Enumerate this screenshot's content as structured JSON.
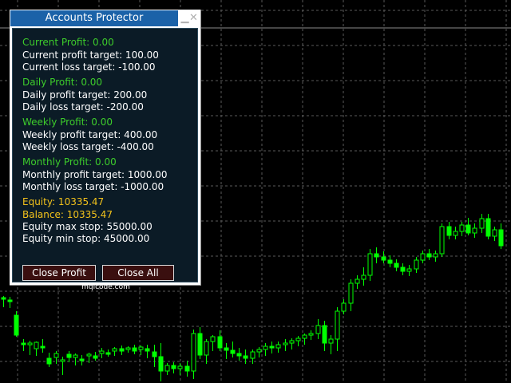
{
  "window": {
    "title": "Accounts Protector",
    "minimize_glyph": "▁",
    "close_glyph": "✕"
  },
  "current": {
    "profit_label": "Current Profit: 0.00",
    "profit_target": "Current profit target: 100.00",
    "loss_target": "Current loss target: -100.00"
  },
  "daily": {
    "profit_label": "Daily Profit: 0.00",
    "profit_target": "Daily profit target: 200.00",
    "loss_target": "Daily loss target: -200.00"
  },
  "weekly": {
    "profit_label": "Weekly Profit: 0.00",
    "profit_target": "Weekly profit target: 400.00",
    "loss_target": "Weekly loss target: -400.00"
  },
  "monthly": {
    "profit_label": "Monthly Profit: 0.00",
    "profit_target": "Monthly profit target: 1000.00",
    "loss_target": "Monthly loss target: -1000.00"
  },
  "account": {
    "equity": "Equity: 10335.47",
    "balance": "Balance: 10335.47",
    "equity_max_stop": "Equity max stop: 55000.00",
    "equity_min_stop": "Equity min stop: 45000.00"
  },
  "buttons": {
    "close_profit": "Close Profit",
    "close_all": "Close All"
  },
  "footer": {
    "site": "mqlcode.com"
  },
  "colors": {
    "background": "#000000",
    "grid": "#5a5a5a",
    "candle": "#00ff00",
    "caption": "#1b62a8",
    "panel": "#0b1b26",
    "profit_text": "#3dcc2b",
    "account_text": "#f2c21b",
    "button_bg": "#3a0f0f"
  },
  "chart_data": {
    "type": "candlestick",
    "series": [
      {
        "values": [
          {
            "open": 373,
            "high": 371,
            "low": 385,
            "close": 375
          },
          {
            "open": 376,
            "high": 372,
            "low": 386,
            "close": 378
          },
          {
            "open": 395,
            "high": 390,
            "low": 422,
            "close": 420
          },
          {
            "open": 430,
            "high": 425,
            "low": 440,
            "close": 432
          },
          {
            "open": 432,
            "high": 427,
            "low": 445,
            "close": 430
          },
          {
            "open": 437,
            "high": 428,
            "low": 446,
            "close": 429
          },
          {
            "open": 434,
            "high": 425,
            "low": 442,
            "close": 436
          },
          {
            "open": 449,
            "high": 442,
            "low": 460,
            "close": 456
          },
          {
            "open": 448,
            "high": 440,
            "low": 456,
            "close": 443
          },
          {
            "open": 453,
            "high": 447,
            "low": 470,
            "close": 451
          },
          {
            "open": 444,
            "high": 440,
            "low": 454,
            "close": 448
          },
          {
            "open": 448,
            "high": 443,
            "low": 458,
            "close": 445
          },
          {
            "open": 450,
            "high": 445,
            "low": 458,
            "close": 452
          },
          {
            "open": 446,
            "high": 442,
            "low": 455,
            "close": 444
          },
          {
            "open": 446,
            "high": 441,
            "low": 452,
            "close": 449
          },
          {
            "open": 443,
            "high": 436,
            "low": 449,
            "close": 440
          },
          {
            "open": 442,
            "high": 438,
            "low": 447,
            "close": 444
          },
          {
            "open": 440,
            "high": 435,
            "low": 446,
            "close": 437
          },
          {
            "open": 437,
            "high": 433,
            "low": 445,
            "close": 440
          },
          {
            "open": 438,
            "high": 434,
            "low": 442,
            "close": 436
          },
          {
            "open": 436,
            "high": 432,
            "low": 444,
            "close": 440
          },
          {
            "open": 438,
            "high": 433,
            "low": 445,
            "close": 435
          },
          {
            "open": 437,
            "high": 432,
            "low": 449,
            "close": 440
          },
          {
            "open": 441,
            "high": 432,
            "low": 460,
            "close": 447
          },
          {
            "open": 447,
            "high": 430,
            "low": 478,
            "close": 465
          },
          {
            "open": 465,
            "high": 455,
            "low": 470,
            "close": 458
          },
          {
            "open": 458,
            "high": 454,
            "low": 468,
            "close": 462
          },
          {
            "open": 462,
            "high": 455,
            "low": 470,
            "close": 459
          },
          {
            "open": 459,
            "high": 452,
            "low": 472,
            "close": 465
          },
          {
            "open": 465,
            "high": 413,
            "low": 475,
            "close": 418
          },
          {
            "open": 418,
            "high": 410,
            "low": 450,
            "close": 445
          },
          {
            "open": 445,
            "high": 425,
            "low": 456,
            "close": 428
          },
          {
            "open": 428,
            "high": 420,
            "low": 440,
            "close": 422
          },
          {
            "open": 422,
            "high": 414,
            "low": 440,
            "close": 436
          },
          {
            "open": 436,
            "high": 430,
            "low": 450,
            "close": 439
          },
          {
            "open": 439,
            "high": 428,
            "low": 448,
            "close": 443
          },
          {
            "open": 443,
            "high": 436,
            "low": 452,
            "close": 446
          },
          {
            "open": 446,
            "high": 438,
            "low": 456,
            "close": 449
          },
          {
            "open": 449,
            "high": 438,
            "low": 456,
            "close": 441
          },
          {
            "open": 441,
            "high": 435,
            "low": 448,
            "close": 438
          },
          {
            "open": 438,
            "high": 430,
            "low": 446,
            "close": 434
          },
          {
            "open": 434,
            "high": 428,
            "low": 443,
            "close": 436
          },
          {
            "open": 436,
            "high": 428,
            "low": 442,
            "close": 432
          },
          {
            "open": 432,
            "high": 425,
            "low": 440,
            "close": 430
          },
          {
            "open": 430,
            "high": 424,
            "low": 438,
            "close": 427
          },
          {
            "open": 427,
            "high": 421,
            "low": 434,
            "close": 424
          },
          {
            "open": 424,
            "high": 418,
            "low": 432,
            "close": 420
          },
          {
            "open": 420,
            "high": 414,
            "low": 426,
            "close": 418
          },
          {
            "open": 418,
            "high": 400,
            "low": 425,
            "close": 408
          },
          {
            "open": 408,
            "high": 402,
            "low": 440,
            "close": 430
          },
          {
            "open": 430,
            "high": 420,
            "low": 444,
            "close": 425
          },
          {
            "open": 425,
            "high": 385,
            "low": 440,
            "close": 390
          },
          {
            "open": 390,
            "high": 375,
            "low": 394,
            "close": 380
          },
          {
            "open": 380,
            "high": 350,
            "low": 390,
            "close": 355
          },
          {
            "open": 355,
            "high": 345,
            "low": 362,
            "close": 350
          },
          {
            "open": 350,
            "high": 335,
            "low": 358,
            "close": 345
          },
          {
            "open": 345,
            "high": 312,
            "low": 352,
            "close": 318
          },
          {
            "open": 318,
            "high": 310,
            "low": 330,
            "close": 322
          },
          {
            "open": 322,
            "high": 315,
            "low": 330,
            "close": 326
          },
          {
            "open": 326,
            "high": 320,
            "low": 335,
            "close": 330
          },
          {
            "open": 330,
            "high": 325,
            "low": 340,
            "close": 335
          },
          {
            "open": 335,
            "high": 330,
            "low": 345,
            "close": 340
          },
          {
            "open": 340,
            "high": 332,
            "low": 346,
            "close": 337
          },
          {
            "open": 337,
            "high": 322,
            "low": 342,
            "close": 326
          },
          {
            "open": 326,
            "high": 314,
            "low": 330,
            "close": 318
          },
          {
            "open": 318,
            "high": 312,
            "low": 326,
            "close": 322
          },
          {
            "open": 322,
            "high": 314,
            "low": 328,
            "close": 318
          },
          {
            "open": 318,
            "high": 280,
            "low": 322,
            "close": 284
          },
          {
            "open": 284,
            "high": 278,
            "low": 300,
            "close": 295
          },
          {
            "open": 295,
            "high": 284,
            "low": 300,
            "close": 290
          },
          {
            "open": 290,
            "high": 278,
            "low": 296,
            "close": 282
          },
          {
            "open": 282,
            "high": 273,
            "low": 295,
            "close": 292
          },
          {
            "open": 292,
            "high": 280,
            "low": 298,
            "close": 286
          },
          {
            "open": 286,
            "high": 268,
            "low": 292,
            "close": 274
          },
          {
            "open": 274,
            "high": 268,
            "low": 300,
            "close": 296
          },
          {
            "open": 296,
            "high": 284,
            "low": 302,
            "close": 288
          },
          {
            "open": 288,
            "high": 280,
            "low": 312,
            "close": 308
          }
        ]
      }
    ]
  }
}
